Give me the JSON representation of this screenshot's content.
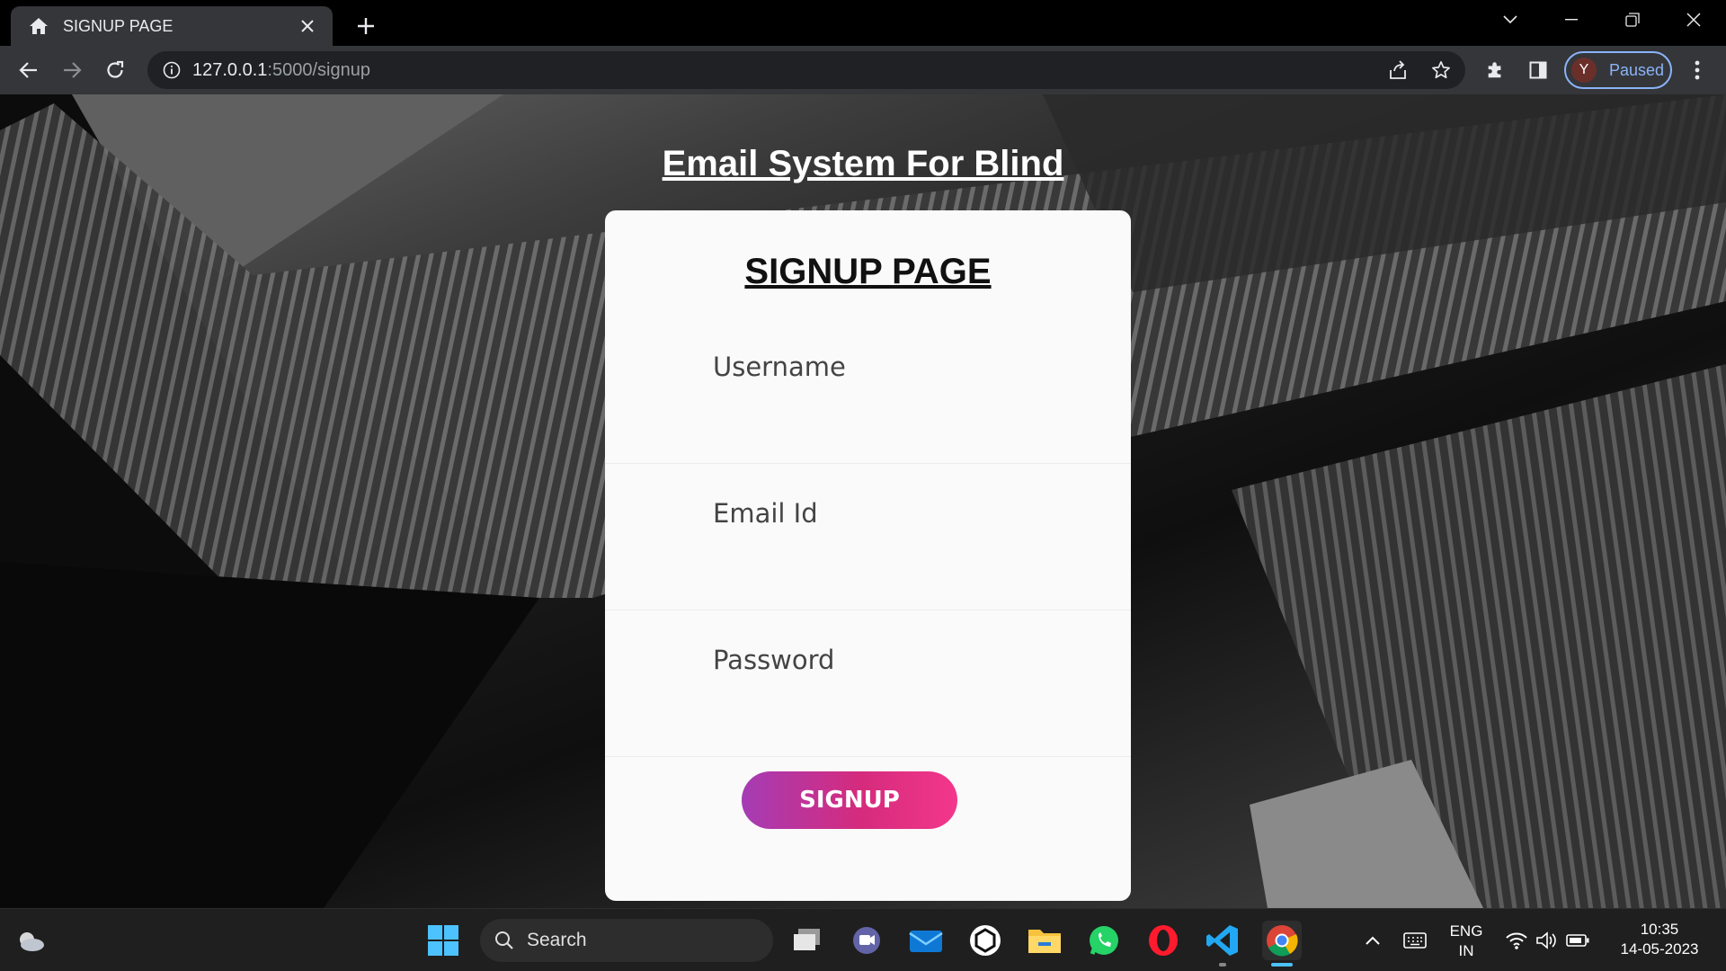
{
  "browser": {
    "tab_title": "SIGNUP PAGE",
    "url_host": "127.0.0.1",
    "url_path": ":5000/signup",
    "profile_initial": "Y",
    "profile_status": "Paused"
  },
  "page": {
    "site_title": "Email System For Blind",
    "card_title": "SIGNUP PAGE",
    "username_placeholder": "Username",
    "email_placeholder": "Email Id",
    "password_placeholder": "Password",
    "signup_label": "SIGNUP"
  },
  "taskbar": {
    "search_label": "Search",
    "language_line1": "ENG",
    "language_line2": "IN",
    "time": "10:35",
    "date": "14-05-2023"
  },
  "colors": {
    "button_gradient_start": "#a53cb4",
    "button_gradient_end": "#f3378b",
    "profile_accent": "#8ab4f8"
  }
}
